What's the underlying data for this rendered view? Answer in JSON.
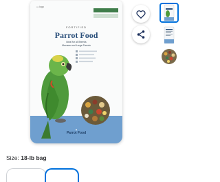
{
  "colors": {
    "accent": "#0071dc",
    "bag_blue": "#6f9fcf",
    "title_blue": "#2a4f7a",
    "ribbon_green": "#3f7d4a",
    "parrot_green": "#4f9a3c"
  },
  "icons": {
    "favorite": "heart-icon",
    "share": "share-icon"
  },
  "product": {
    "image_alt": "Parrot Food bag",
    "packaging": {
      "fortified_label": "FORTIFIED",
      "title": "Parrot Food",
      "tagline": "Ideal for all Breeds",
      "subline": "Macaws and Large Parrots",
      "brand_bottom": "Parrot Food"
    }
  },
  "selection": {
    "size_label": "Size:",
    "size_value": "18-lb bag"
  },
  "thumbnails": [
    {
      "name": "front",
      "selected": true
    },
    {
      "name": "back",
      "selected": false
    },
    {
      "name": "kibble",
      "selected": false
    }
  ]
}
